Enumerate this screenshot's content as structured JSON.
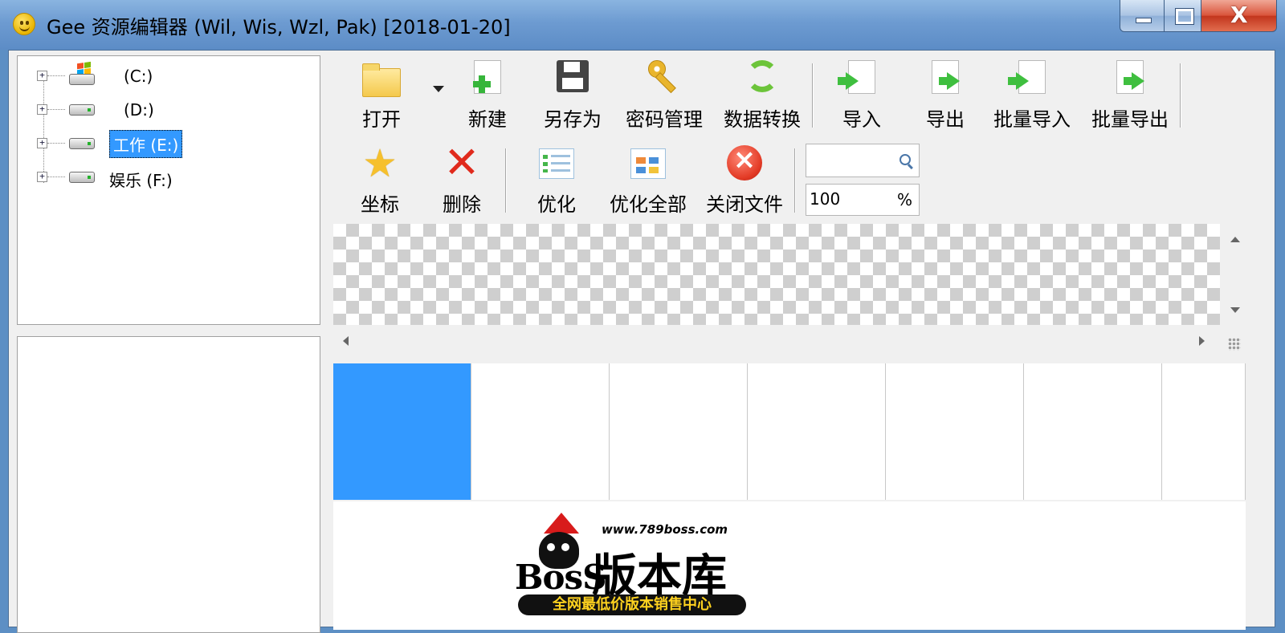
{
  "window": {
    "title": "Gee 资源编辑器 (Wil, Wis, Wzl, Pak) [2018-01-20]",
    "close_glyph": "X"
  },
  "tree": {
    "items": [
      {
        "label": "(C:)"
      },
      {
        "label": "(D:)"
      },
      {
        "label": "工作 (E:)"
      },
      {
        "label": "娱乐 (F:)"
      }
    ],
    "expander": "+"
  },
  "toolbar": {
    "open": "打开",
    "new": "新建",
    "save_as": "另存为",
    "password": "密码管理",
    "convert": "数据转换",
    "import": "导入",
    "export": "导出",
    "batch_import": "批量导入",
    "batch_export": "批量导出",
    "coords": "坐标",
    "delete": "删除",
    "optimize": "优化",
    "optimize_all": "优化全部",
    "close_file": "关闭文件"
  },
  "search": {
    "placeholder": ""
  },
  "zoom": {
    "value": "100",
    "unit": "%"
  },
  "watermark": {
    "url": "www.789boss.com",
    "brand": "BosS",
    "title": "版本库",
    "slogan": "全网最低价版本销售中心"
  },
  "colors": {
    "selection": "#3399ff",
    "titlebar": "#6d9bd1"
  }
}
